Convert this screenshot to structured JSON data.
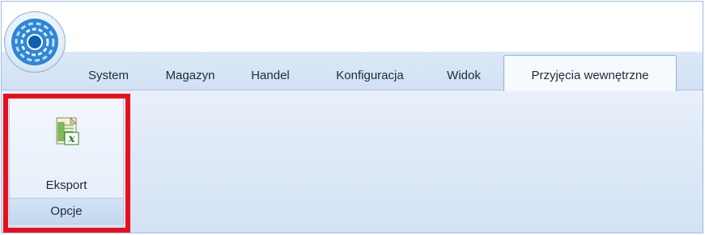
{
  "ribbon": {
    "tabs": [
      {
        "label": "System"
      },
      {
        "label": "Magazyn"
      },
      {
        "label": "Handel"
      },
      {
        "label": "Konfiguracja"
      },
      {
        "label": "Widok"
      },
      {
        "label": "Przyjęcia wewnętrzne",
        "active": true
      }
    ],
    "groups": [
      {
        "caption": "Opcje",
        "buttons": [
          {
            "label": "Eksport",
            "icon": "excel-export-icon"
          }
        ]
      }
    ]
  },
  "colors": {
    "highlight": "#e8101c",
    "tab_strip": "#d2e1f3",
    "ribbon": "#dce8f6"
  }
}
